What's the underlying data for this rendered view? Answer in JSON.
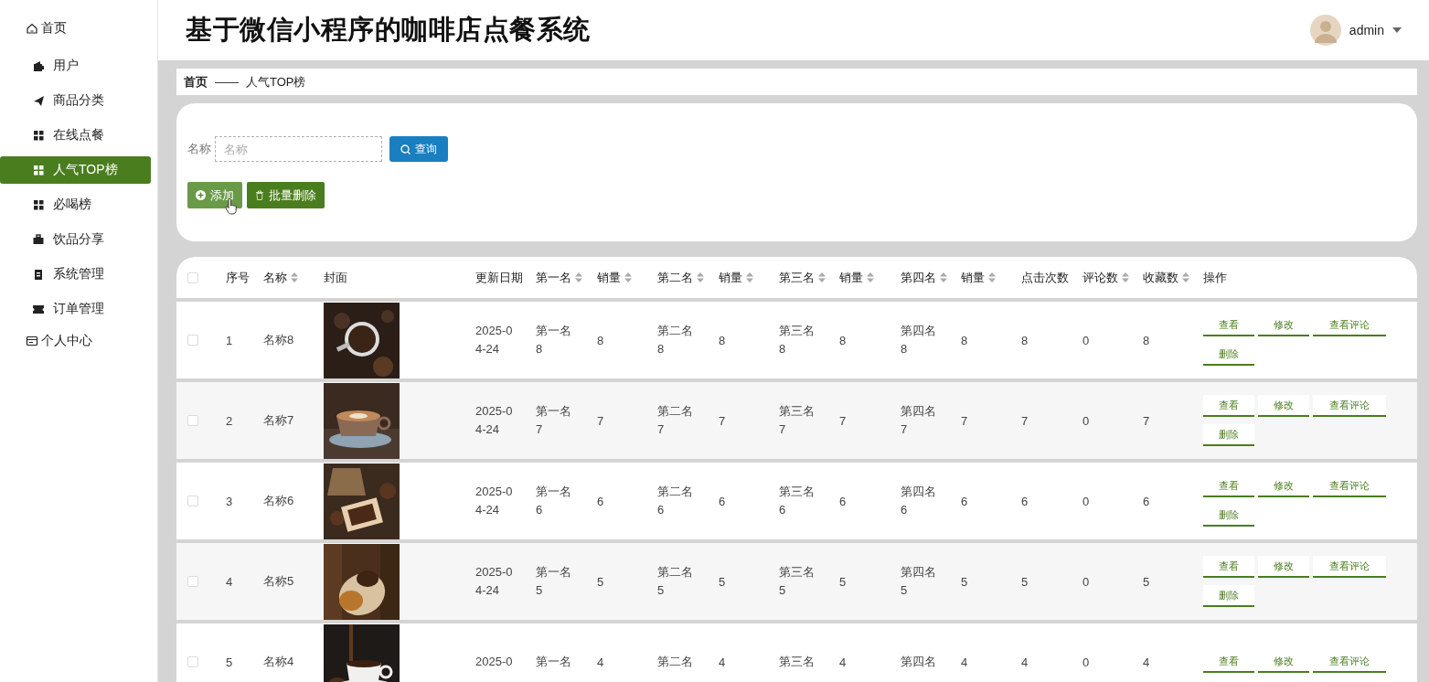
{
  "header": {
    "title": "基于微信小程序的咖啡店点餐系统",
    "user": "admin"
  },
  "sidebar": {
    "items": [
      {
        "label": "首页",
        "selected": false,
        "children": [
          {
            "label": "用户",
            "selected": false
          },
          {
            "label": "商品分类",
            "selected": false
          },
          {
            "label": "在线点餐",
            "selected": false
          },
          {
            "label": "人气TOP榜",
            "selected": true
          },
          {
            "label": "必喝榜",
            "selected": false
          },
          {
            "label": "饮品分享",
            "selected": false
          },
          {
            "label": "系统管理",
            "selected": false
          },
          {
            "label": "订单管理",
            "selected": false
          }
        ]
      },
      {
        "label": "个人中心",
        "selected": false
      }
    ]
  },
  "breadcrumb": {
    "items": [
      "首页",
      "人气TOP榜"
    ],
    "separator": "——"
  },
  "search": {
    "label": "名称",
    "placeholder": "名称",
    "button": "查询"
  },
  "actions": [
    {
      "label": "添加",
      "kind": "add",
      "hovered": true
    },
    {
      "label": "批量删除",
      "kind": "delete",
      "hovered": false
    }
  ],
  "table": {
    "select_all": {
      "checked": false
    },
    "columns": [
      {
        "label": "序号",
        "sortable": false
      },
      {
        "label": "名称",
        "sortable": true
      },
      {
        "label": "封面",
        "sortable": false
      },
      {
        "label": "更新日期",
        "sortable": false
      },
      {
        "label": "第一名",
        "sortable": true
      },
      {
        "label": "销量",
        "sortable": true
      },
      {
        "label": "第二名",
        "sortable": true
      },
      {
        "label": "销量",
        "sortable": true
      },
      {
        "label": "第三名",
        "sortable": true
      },
      {
        "label": "销量",
        "sortable": true
      },
      {
        "label": "第四名",
        "sortable": true
      },
      {
        "label": "销量",
        "sortable": true
      },
      {
        "label": "点击次数",
        "sortable": false
      },
      {
        "label": "评论数",
        "sortable": true
      },
      {
        "label": "收藏数",
        "sortable": true
      },
      {
        "label": "操作",
        "sortable": false
      }
    ],
    "rows": [
      {
        "checked": false,
        "cells": [
          "1",
          "名称8",
          {
            "kind": "picture"
          },
          "2025-04-24",
          "第一名8",
          "8",
          "第二名8",
          "8",
          "第三名8",
          "8",
          "第四名8",
          "8",
          "8",
          "0",
          "8"
        ],
        "buttons": [
          "查看",
          "修改",
          "查看评论",
          "删除"
        ]
      },
      {
        "checked": false,
        "cells": [
          "2",
          "名称7",
          {
            "kind": "picture"
          },
          "2025-04-24",
          "第一名7",
          "7",
          "第二名7",
          "7",
          "第三名7",
          "7",
          "第四名7",
          "7",
          "7",
          "0",
          "7"
        ],
        "buttons": [
          "查看",
          "修改",
          "查看评论",
          "删除"
        ]
      },
      {
        "checked": false,
        "cells": [
          "3",
          "名称6",
          {
            "kind": "picture"
          },
          "2025-04-24",
          "第一名6",
          "6",
          "第二名6",
          "6",
          "第三名6",
          "6",
          "第四名6",
          "6",
          "6",
          "0",
          "6"
        ],
        "buttons": [
          "查看",
          "修改",
          "查看评论",
          "删除"
        ]
      },
      {
        "checked": false,
        "cells": [
          "4",
          "名称5",
          {
            "kind": "picture"
          },
          "2025-04-24",
          "第一名5",
          "5",
          "第二名5",
          "5",
          "第三名5",
          "5",
          "第四名5",
          "5",
          "5",
          "0",
          "5"
        ],
        "buttons": [
          "查看",
          "修改",
          "查看评论",
          "删除"
        ]
      },
      {
        "checked": false,
        "cells": [
          "5",
          "名称4",
          {
            "kind": "picture"
          },
          "2025-0",
          "第一名",
          "4",
          "第二名",
          "4",
          "第三名",
          "4",
          "第四名",
          "4",
          "4",
          "0",
          "4"
        ],
        "buttons": [
          "查看",
          "修改",
          "查看评论"
        ]
      }
    ]
  }
}
